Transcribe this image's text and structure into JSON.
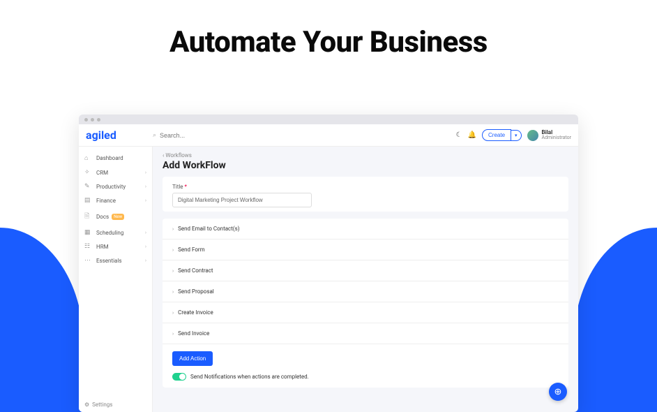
{
  "hero": {
    "title": "Automate Your Business"
  },
  "logo": "agiled",
  "search": {
    "placeholder": "Search..."
  },
  "header": {
    "create_label": "Create",
    "user_name": "Bilal",
    "user_role": "Administrator"
  },
  "sidebar": {
    "items": [
      {
        "label": "Dashboard",
        "icon": "⌂"
      },
      {
        "label": "CRM",
        "icon": "✧"
      },
      {
        "label": "Productivity",
        "icon": "✎"
      },
      {
        "label": "Finance",
        "icon": "▤"
      },
      {
        "label": "Docs",
        "icon": "🗎",
        "badge": "New"
      },
      {
        "label": "Scheduling",
        "icon": "▦"
      },
      {
        "label": "HRM",
        "icon": "☷"
      },
      {
        "label": "Essentials",
        "icon": "⋯"
      }
    ],
    "settings_label": "Settings"
  },
  "breadcrumb": "‹ Workflows",
  "page_title": "Add WorkFlow",
  "form": {
    "title_label": "Title",
    "title_value": "Digital Marketing Project Workflow"
  },
  "actions": [
    "Send Email to Contact(s)",
    "Send Form",
    "Send Contract",
    "Send Proposal",
    "Create Invoice",
    "Send Invoice"
  ],
  "add_action_label": "Add Action",
  "notify_label": "Send Notifications when actions are completed."
}
